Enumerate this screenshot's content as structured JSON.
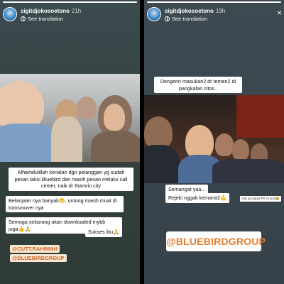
{
  "left_story": {
    "username": "sigitdjokosoetono",
    "time": "21h",
    "see_translation": "See translation",
    "progress": 1.0,
    "caption_main": "Alhamdulillah kenalan dgn pelanggan yg sudah pesan taksi Bluebird dan masih pesan melalui call center, naik dr thamrin city",
    "caption_2": "Belanjaan nya banyak😁, untung masih muat di transmover nya",
    "caption_3_line1": "Semoga sekarang akan downloaded mybb",
    "caption_3_line2": "juga👍🙏",
    "caption_3_extra": "Sukses ibu🙏",
    "mention_1": "@CUTT.RAHIMAH",
    "mention_2": "@BLUEBIRDGROUP"
  },
  "right_story": {
    "username": "sigitdjokosoetono",
    "time": "19h",
    "see_translation": "See translation",
    "progress": 1.0,
    "caption_top": "Dengerin masukan2 dr temen2 di pangkalan citos..",
    "caption_mid_1": "Semangat yaa...",
    "caption_mid_2": "Rejeki nggak kemana2💪",
    "tiny_caption": "Ada yg dapat PR di pool😂",
    "brand_tag": "@BLUEBIRDGROUP"
  },
  "icons": {
    "close": "×"
  },
  "colors": {
    "brand_orange": "#e67d2e",
    "pill_bg": "#f7e9d2"
  }
}
